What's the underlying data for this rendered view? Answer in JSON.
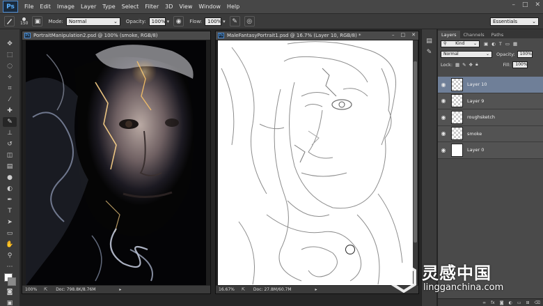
{
  "app": {
    "logo": "Ps"
  },
  "menu": [
    "File",
    "Edit",
    "Image",
    "Layer",
    "Type",
    "Select",
    "Filter",
    "3D",
    "View",
    "Window",
    "Help"
  ],
  "window_controls": [
    "–",
    "□",
    "✕"
  ],
  "options": {
    "brush_size": "150",
    "mode_label": "Mode:",
    "mode_value": "Normal",
    "opacity_label": "Opacity:",
    "opacity_value": "100%",
    "flow_label": "Flow:",
    "flow_value": "100%",
    "workspace": "Essentials"
  },
  "doc1": {
    "title": "PortraitManipulation2.psd @ 100% (smoke, RGB/8)",
    "zoom": "100%",
    "doc_size": "Doc: 798.8K/8.76M"
  },
  "doc2": {
    "title": "MaleFantasyPortrait1.psd @ 16.7% (Layer 10, RGB/8) *",
    "zoom": "16.67%",
    "doc_size": "Doc: 27.8M/60.7M"
  },
  "layers_panel": {
    "tabs": [
      "Layers",
      "Channels",
      "Paths"
    ],
    "kind_label": "Kind",
    "blend_mode": "Normal",
    "opacity_label": "Opacity:",
    "opacity_value": "100%",
    "lock_label": "Lock:",
    "fill_label": "Fill:",
    "fill_value": "100%",
    "layers": [
      {
        "name": "Layer 10",
        "selected": true
      },
      {
        "name": "Layer 9",
        "selected": false
      },
      {
        "name": "roughsketch",
        "selected": false
      },
      {
        "name": "smoke",
        "selected": false
      },
      {
        "name": "Layer 0",
        "selected": false
      }
    ],
    "footer_icons": [
      "link-icon",
      "fx-icon",
      "mask-icon",
      "adjustment-icon",
      "group-icon",
      "new-layer-icon",
      "trash-icon"
    ]
  },
  "watermark": {
    "brand": "灵感中国",
    "url": "lingganchina.com"
  },
  "colors": {
    "selected_layer": "#6f7f98",
    "ps_blue": "#5ab0ff"
  }
}
